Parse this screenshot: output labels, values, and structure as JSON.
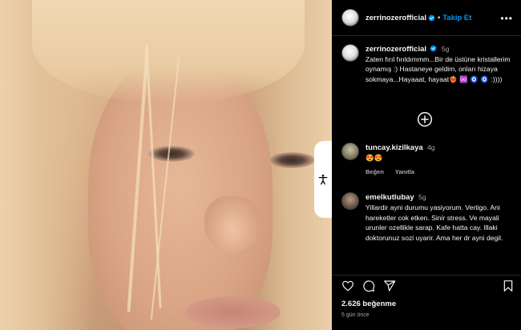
{
  "post": {
    "username": "zerrinozerofficial",
    "follow_label": "Takip Et",
    "separator": "•",
    "more_label": "•••",
    "caption_time": "5g",
    "caption_text": "Zaten fırıl fırıldımmm...Bir de üstüne kristallerim oynamış :) Hastaneye geldim, onları hizaya sokmaya...Hayaaat, hayaat❤️‍🔥 ♾️ 🧿 🧿 :))))",
    "likes": "2.626 beğenme",
    "posted": "5 gün önce"
  },
  "comments": [
    {
      "username": "tuncay.kizilkaya",
      "time": "4g",
      "text": "😍😍",
      "like_label": "Beğen",
      "reply_label": "Yanıtla"
    },
    {
      "username": "emelkutlubay",
      "time": "5g",
      "text": "Yillardir ayni durumu yasiyorum. Vertigo. Ani hareketler cok etken. Sinir stress. Ve mayali urunler ozellikle sarap. Kafe hatta cay. Illaki doktorunuz sozi uyarir. Ama her dr ayni degil.",
      "like_label": "",
      "reply_label": ""
    }
  ],
  "icons": {
    "verified": "verified-badge-icon",
    "add_comment": "plus-circle-icon",
    "like": "heart-icon",
    "comment": "comment-icon",
    "share": "send-icon",
    "save": "bookmark-icon",
    "accessibility": "accessibility-icon"
  },
  "colors": {
    "background": "#000000",
    "link": "#0095f6",
    "secondary_text": "#a8a8a8"
  }
}
